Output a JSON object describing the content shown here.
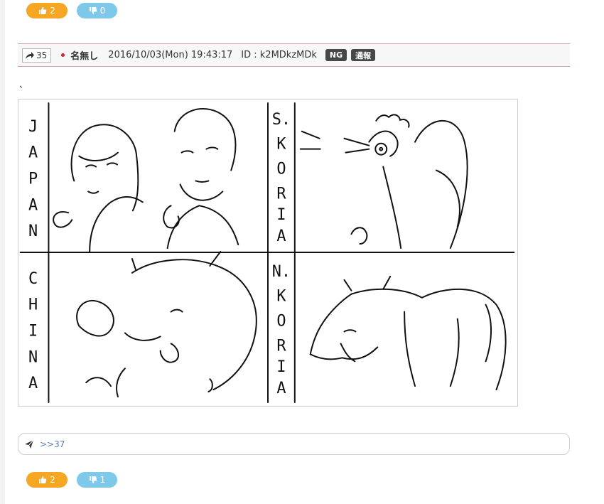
{
  "votes_top": {
    "like": "2",
    "dislike": "0"
  },
  "post": {
    "res_number": "35",
    "name": "名無し",
    "date": "2016/10/03(Mon) 19:43:17",
    "id": "ID : k2MDkzMDk",
    "tags": [
      "NG",
      "通報"
    ],
    "body_text": "、"
  },
  "comic": {
    "panels": [
      {
        "letters": [
          "J",
          "A",
          "P",
          "A",
          "N"
        ]
      },
      {
        "letters": [
          "S.",
          "K",
          "O",
          "R",
          "I",
          "A"
        ]
      },
      {
        "letters": [
          "C",
          "H",
          "I",
          "N",
          "A"
        ]
      },
      {
        "letters": [
          "N.",
          "K",
          "O",
          "R",
          "I",
          "A"
        ]
      }
    ]
  },
  "reply": {
    "link": ">>37"
  },
  "votes_bottom": {
    "like": "2",
    "dislike": "1"
  },
  "colors": {
    "like": "#f5a623",
    "dislike": "#7ec8ea",
    "header_border": "#d9a2a8",
    "link": "#5a7bbd"
  },
  "icons": {
    "like": "thumbs-up-icon",
    "dislike": "thumbs-down-icon",
    "res": "share-arrow-icon",
    "reply": "paper-plane-icon"
  }
}
